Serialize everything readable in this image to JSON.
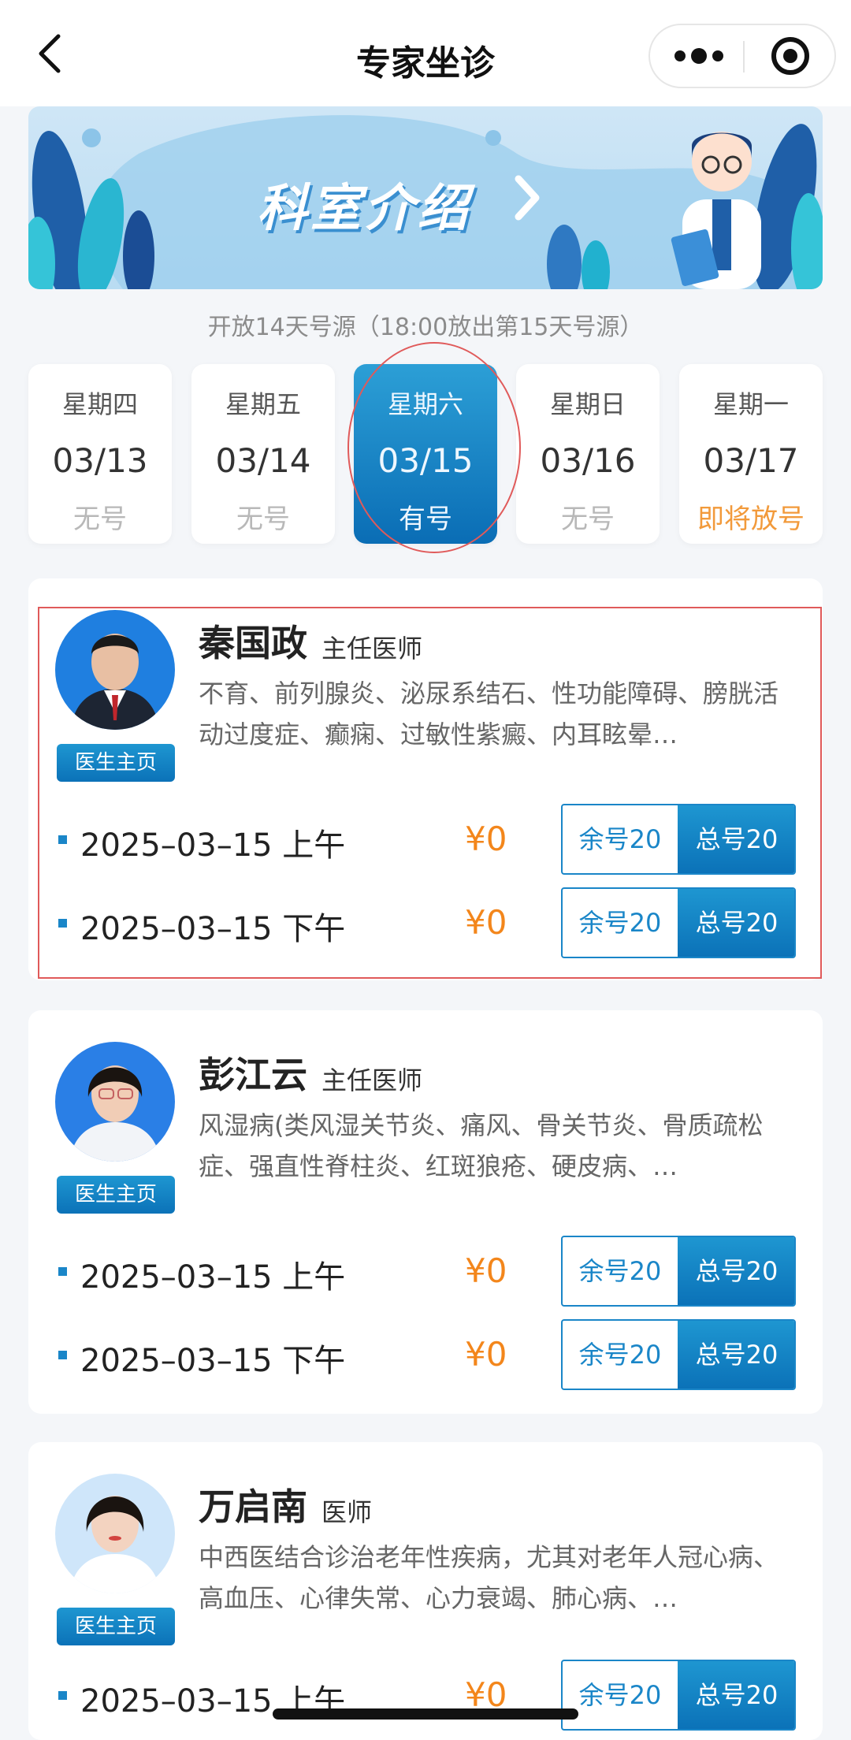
{
  "nav": {
    "title": "专家坐诊"
  },
  "banner": {
    "text": "科室介绍"
  },
  "notice": "开放14天号源（18:00放出第15天号源）",
  "days": [
    {
      "weekday": "星期四",
      "date": "03/13",
      "status": "无号"
    },
    {
      "weekday": "星期五",
      "date": "03/14",
      "status": "无号"
    },
    {
      "weekday": "星期六",
      "date": "03/15",
      "status": "有号"
    },
    {
      "weekday": "星期日",
      "date": "03/16",
      "status": "无号"
    },
    {
      "weekday": "星期一",
      "date": "03/17",
      "status": "即将放号"
    }
  ],
  "doctors": [
    {
      "name": "秦国政",
      "title": "主任医师",
      "desc": "不育、前列腺炎、泌尿系结石、性功能障碍、膀胱活动过度症、癫痫、过敏性紫癜、内耳眩晕…",
      "home_label": "医生主页",
      "slots": [
        {
          "text": "2025–03–15  上午",
          "price": "¥0",
          "remain": "余号20",
          "total": "总号20"
        },
        {
          "text": "2025–03–15  下午",
          "price": "¥0",
          "remain": "余号20",
          "total": "总号20"
        }
      ]
    },
    {
      "name": "彭江云",
      "title": "主任医师",
      "desc": "风湿病(类风湿关节炎、痛风、骨关节炎、骨质疏松症、强直性脊柱炎、红斑狼疮、硬皮病、…",
      "home_label": "医生主页",
      "slots": [
        {
          "text": "2025–03–15  上午",
          "price": "¥0",
          "remain": "余号20",
          "total": "总号20"
        },
        {
          "text": "2025–03–15  下午",
          "price": "¥0",
          "remain": "余号20",
          "total": "总号20"
        }
      ]
    },
    {
      "name": "万启南",
      "title": "医师",
      "desc": "中西医结合诊治老年性疾病，尤其对老年人冠心病、高血压、心律失常、心力衰竭、肺心病、…",
      "home_label": "医生主页",
      "slots": [
        {
          "text": "2025–03–15  上午",
          "price": "¥0",
          "remain": "余号20",
          "total": "总号20"
        }
      ]
    }
  ]
}
